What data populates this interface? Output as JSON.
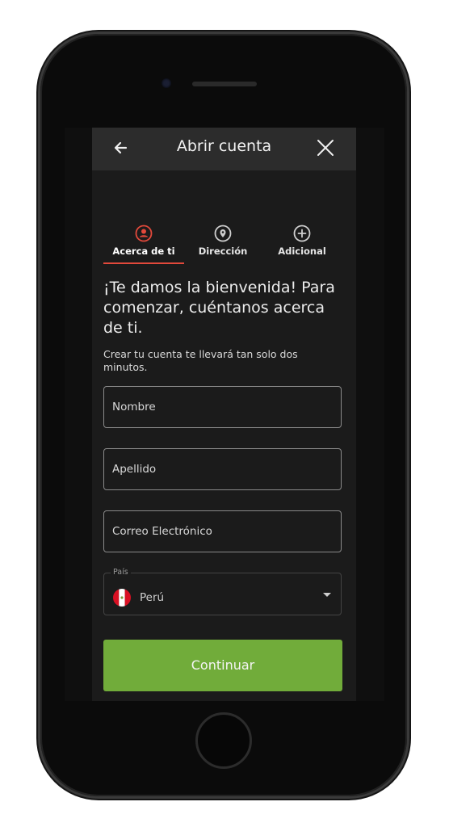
{
  "appbar": {
    "title": "Abrir cuenta"
  },
  "steps": [
    {
      "label": "Acerca de ti",
      "icon": "user-icon",
      "active": true
    },
    {
      "label": "Dirección",
      "icon": "location-pin-icon",
      "active": false
    },
    {
      "label": "Adicional",
      "icon": "plus-circle-icon",
      "active": false
    }
  ],
  "welcome": {
    "heading": "¡Te damos la bienvenida! Para comenzar, cuéntanos acerca de ti.",
    "subtext": "Crear tu cuenta te llevará tan solo dos minutos."
  },
  "form": {
    "first_name_placeholder": "Nombre",
    "last_name_placeholder": "Apellido",
    "email_placeholder": "Correo Electrónico",
    "country_label": "País",
    "country_value": "Perú"
  },
  "continue_label": "Continuar",
  "colors": {
    "accent": "#e2493b",
    "primary_button": "#71ac3a",
    "appbar": "#2c2c2c",
    "background": "#1b1b1b"
  }
}
